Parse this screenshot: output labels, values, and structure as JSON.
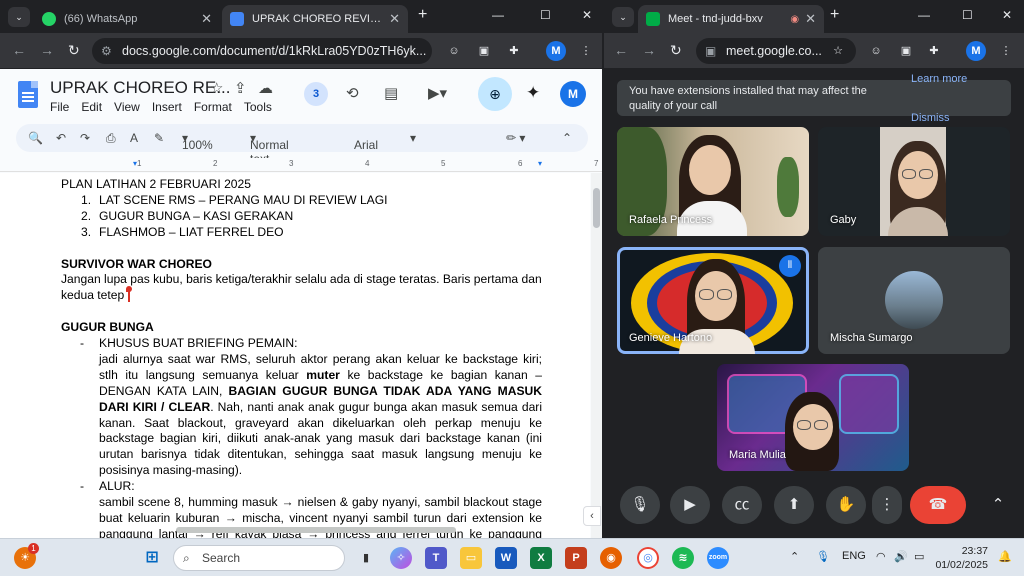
{
  "left_browser": {
    "tabs": [
      {
        "label": "(66) WhatsApp",
        "favicon_color": "#25d366",
        "active": false
      },
      {
        "label": "UPRAK CHOREO REVISI - Google",
        "favicon_color": "#4285f4",
        "active": true
      }
    ],
    "url": "docs.google.com/document/d/1kRkLra05YD0zTH6yk..."
  },
  "docs": {
    "title": "UPRAK CHOREO RE...",
    "menu": [
      "File",
      "Edit",
      "View",
      "Insert",
      "Format",
      "Tools"
    ],
    "collaborators_count": "3",
    "avatar_letter": "M",
    "toolbar": {
      "zoom": "100%",
      "style": "Normal text",
      "font": "Arial"
    },
    "ruler_marks": [
      "1",
      "2",
      "3",
      "4",
      "5",
      "6",
      "7"
    ],
    "content": {
      "heading1": "PLAN LATIHAN 2 FEBRUARI 2025",
      "list": [
        {
          "num": "1.",
          "text": "LAT SCENE RMS – PERANG MAU DI REVIEW LAGI"
        },
        {
          "num": "2.",
          "text": "GUGUR BUNGA – KASI GERAKAN"
        },
        {
          "num": "3.",
          "text": "FLASHMOB – LIAT FERREL DEO"
        }
      ],
      "heading2": "SURVIVOR WAR CHOREO",
      "para2": "Jangan lupa pas kubu, baris ketiga/terakhir selalu ada di stage teratas. Baris pertama dan kedua tetep",
      "heading3": "GUGUR BUNGA",
      "bullet1_title": "KHUSUS BUAT BRIEFING PEMAIN:",
      "bullet1_a": "jadi alurnya saat war RMS, seluruh aktor perang akan keluar ke backstage kiri; stlh itu langsung semuanya keluar ",
      "bullet1_b": "muter",
      "bullet1_c": " ke backstage ke bagian kanan – DENGAN KATA LAIN, ",
      "bullet1_d": "BAGIAN GUGUR BUNGA TIDAK ADA YANG MASUK DARI KIRI / CLEAR",
      "bullet1_e": ". Nah, nanti anak anak gugur bunga akan masuk semua dari kanan. Saat blackout, graveyard akan dikeluarkan oleh perkap menuju ke backstage bagian kiri, diikuti anak-anak yang masuk dari backstage kanan (ini urutan barisnya tidak ditentukan, sehingga saat masuk langsung menuju ke posisinya masing-masing).",
      "bullet2_title": "ALUR:",
      "bullet2_text": "sambil scene 8, humming masuk → nielsen & gaby nyanyi, sambil blackout stage buat keluarin kuburan → mischa, vincent nyanyi sambil turun dari extension ke panggung lantai → reff kayak biasa → princess and ferrel turun ke panggung lantai"
    }
  },
  "meet_browser": {
    "tab": {
      "label": "Meet - tnd-judd-bxv",
      "favicon_color": "#00ac47"
    },
    "url": "meet.google.co...",
    "avatar_letter": "M",
    "banner": {
      "text": "You have extensions installed that may affect the quality of your call",
      "learn_more": "Learn more",
      "dismiss": "Dismiss"
    },
    "participants": [
      {
        "name": "Rafaela Princess"
      },
      {
        "name": "Gaby"
      },
      {
        "name": "Genieve Hartono"
      },
      {
        "name": "Mischa Sumargo"
      },
      {
        "name": "Maria Mulia"
      }
    ]
  },
  "taskbar": {
    "search_placeholder": "Search",
    "notification_badge": "1",
    "lang": "ENG",
    "time": "23:37",
    "date": "01/02/2025"
  }
}
